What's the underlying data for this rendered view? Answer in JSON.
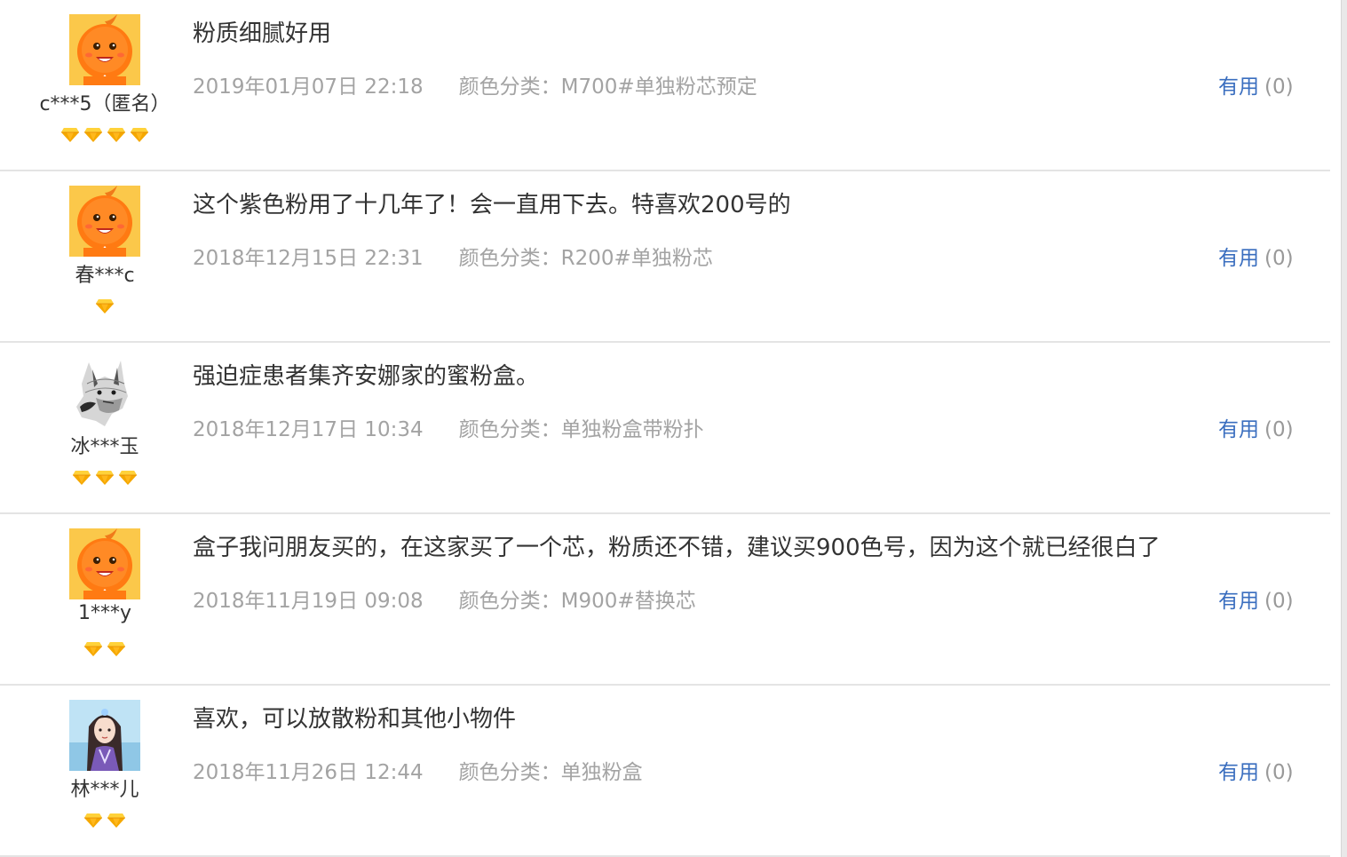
{
  "colors": {
    "link_blue": "#3a6ebf",
    "meta_gray": "#a3a3a3",
    "text_dark": "#333333",
    "divider": "#e4e4e4",
    "gem_gold": "#f5a800"
  },
  "reviews": [
    {
      "avatar": "orange-mascot-avatar",
      "username": "c***5（匿名）",
      "level_gems": 4,
      "content": "粉质细腻好用",
      "date": "2019年01月07日 22:18",
      "sku": "颜色分类：M700#单独粉芯预定",
      "useful_label": "有用",
      "useful_count": "(0)"
    },
    {
      "avatar": "orange-mascot-avatar",
      "username": "春***c",
      "level_gems": 1,
      "content": "这个紫色粉用了十几年了！会一直用下去。特喜欢200号的",
      "date": "2018年12月15日 22:31",
      "sku": "颜色分类：R200#单独粉芯",
      "useful_label": "有用",
      "useful_count": "(0)"
    },
    {
      "avatar": "dog-sketch-avatar",
      "username": "冰***玉",
      "level_gems": 3,
      "content": "强迫症患者集齐安娜家的蜜粉盒。",
      "date": "2018年12月17日 10:34",
      "sku": "颜色分类：单独粉盒带粉扑",
      "useful_label": "有用",
      "useful_count": "(0)"
    },
    {
      "avatar": "orange-mascot-avatar",
      "username": "1***y",
      "level_gems": 2,
      "content": "盒子我问朋友买的，在这家买了一个芯，粉质还不错，建议买900色号，因为这个就已经很白了",
      "date": "2018年11月19日 09:08",
      "sku": "颜色分类：M900#替换芯",
      "useful_label": "有用",
      "useful_count": "(0)"
    },
    {
      "avatar": "girl-portrait-avatar",
      "username": "林***儿",
      "level_gems": 2,
      "content": "喜欢，可以放散粉和其他小物件",
      "date": "2018年11月26日 12:44",
      "sku": "颜色分类：单独粉盒",
      "useful_label": "有用",
      "useful_count": "(0)"
    }
  ]
}
